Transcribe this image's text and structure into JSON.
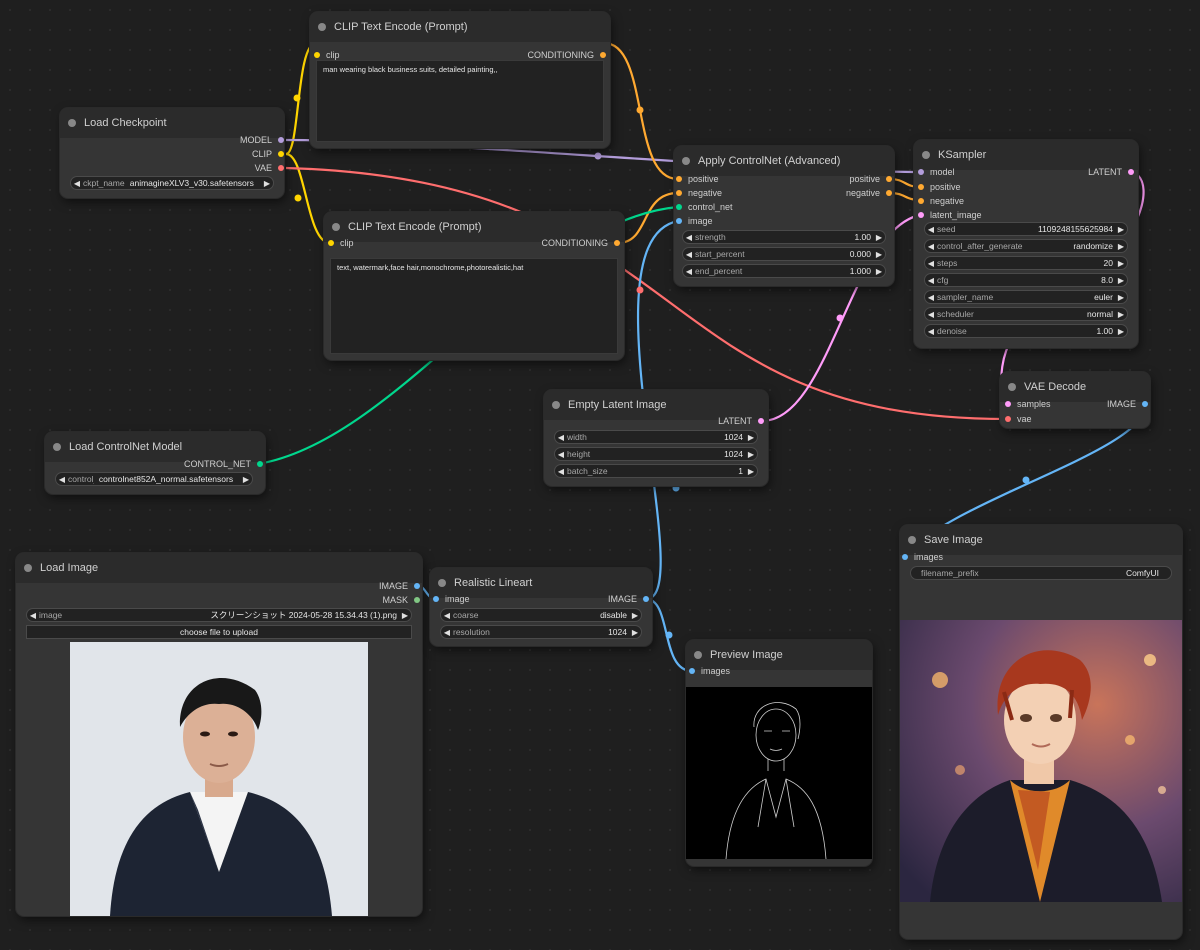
{
  "colors": {
    "clip": "#ffd500",
    "model": "#b39ddb",
    "vae": "#ff6e6e",
    "conditioning": "#ffa931",
    "control_net": "#00d78d",
    "image": "#64b5f6",
    "latent": "#ff9cf9",
    "mask": "#81c784"
  },
  "nodes": {
    "clip_pos": {
      "title": "CLIP Text Encode (Prompt)",
      "in_clip": "clip",
      "out": "CONDITIONING",
      "text": "man wearing black business suits, detailed painting,,"
    },
    "clip_neg": {
      "title": "CLIP Text Encode (Prompt)",
      "in_clip": "clip",
      "out": "CONDITIONING",
      "text": "text, watermark,face hair,monochrome,photorealistic,hat"
    },
    "ckpt": {
      "title": "Load Checkpoint",
      "out_model": "MODEL",
      "out_clip": "CLIP",
      "out_vae": "VAE",
      "w_label": "ckpt_name",
      "w_value": "animagineXLV3_v30.safetensors"
    },
    "apply_cn": {
      "title": "Apply ControlNet (Advanced)",
      "in_positive": "positive",
      "in_negative": "negative",
      "in_control": "control_net",
      "in_image": "image",
      "out_positive": "positive",
      "out_negative": "negative",
      "widgets": [
        {
          "label": "strength",
          "value": "1.00"
        },
        {
          "label": "start_percent",
          "value": "0.000"
        },
        {
          "label": "end_percent",
          "value": "1.000"
        }
      ]
    },
    "ksampler": {
      "title": "KSampler",
      "in_model": "model",
      "in_positive": "positive",
      "in_negative": "negative",
      "in_latent": "latent_image",
      "out": "LATENT",
      "widgets": [
        {
          "label": "seed",
          "value": "1109248155625984"
        },
        {
          "label": "control_after_generate",
          "value": "randomize"
        },
        {
          "label": "steps",
          "value": "20"
        },
        {
          "label": "cfg",
          "value": "8.0"
        },
        {
          "label": "sampler_name",
          "value": "euler"
        },
        {
          "label": "scheduler",
          "value": "normal"
        },
        {
          "label": "denoise",
          "value": "1.00"
        }
      ]
    },
    "vae_decode": {
      "title": "VAE Decode",
      "in_samples": "samples",
      "in_vae": "vae",
      "out": "IMAGE"
    },
    "empty_latent": {
      "title": "Empty Latent Image",
      "out": "LATENT",
      "widgets": [
        {
          "label": "width",
          "value": "1024"
        },
        {
          "label": "height",
          "value": "1024"
        },
        {
          "label": "batch_size",
          "value": "1"
        }
      ]
    },
    "load_cn": {
      "title": "Load ControlNet Model",
      "out": "CONTROL_NET",
      "w_label": "control_net",
      "w_value": "controlnet852A_normal.safetensors"
    },
    "load_image": {
      "title": "Load Image",
      "out_image": "IMAGE",
      "out_mask": "MASK",
      "w_label": "image",
      "w_value": "スクリーンショット 2024-05-28 15.34.43 (1).png",
      "upload": "choose file to upload"
    },
    "lineart": {
      "title": "Realistic Lineart",
      "in_image": "image",
      "out": "IMAGE",
      "widgets": [
        {
          "label": "coarse",
          "value": "disable"
        },
        {
          "label": "resolution",
          "value": "1024"
        }
      ]
    },
    "preview": {
      "title": "Preview Image",
      "in_images": "images"
    },
    "save": {
      "title": "Save Image",
      "in_images": "images",
      "w_label": "filename_prefix",
      "w_value": "ComfyUI"
    }
  }
}
